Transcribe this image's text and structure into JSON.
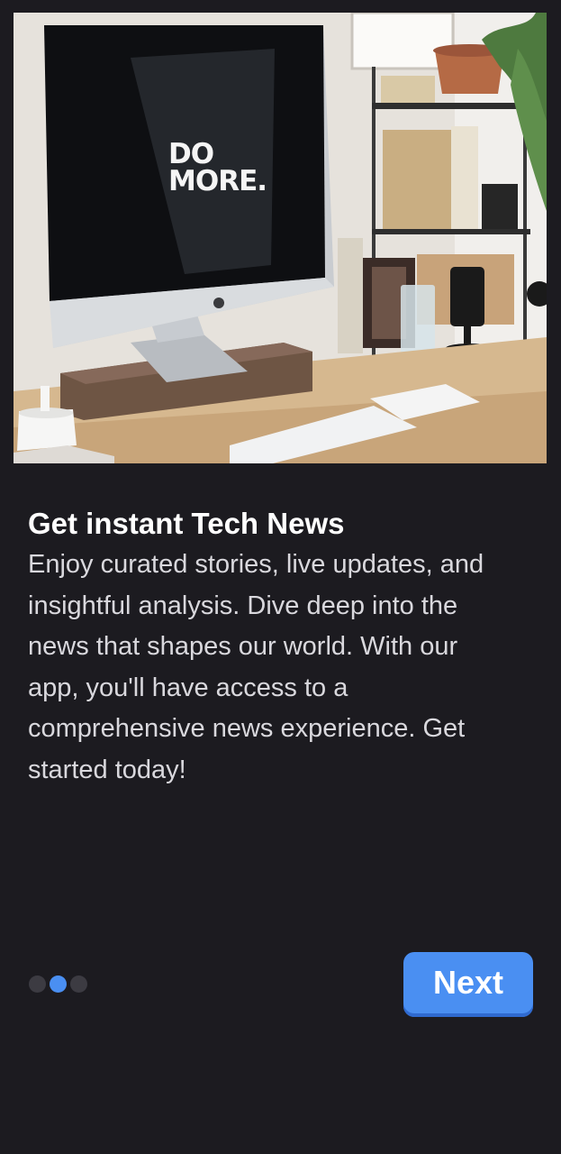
{
  "hero": {
    "image_name": "desk-imac-photo",
    "screen_text_line1": "DO",
    "screen_text_line2": "MORE."
  },
  "content": {
    "title": "Get instant Tech News",
    "body": "Enjoy curated stories, live updates, and insightful analysis. Dive deep into the news that shapes our world. With our app, you'll have access to a comprehensive news experience. Get started today!"
  },
  "pager": {
    "total": 3,
    "active_index": 1
  },
  "actions": {
    "next_label": "Next"
  },
  "colors": {
    "background": "#1c1b20",
    "accent": "#4a8ff2",
    "dot_inactive": "#3c3b42",
    "text_primary": "#ffffff",
    "text_secondary": "#d9d8dd"
  }
}
